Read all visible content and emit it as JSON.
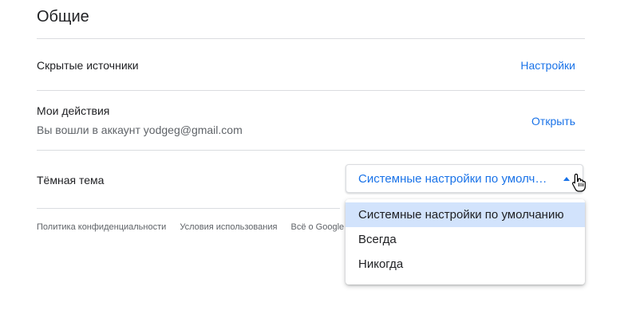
{
  "section": {
    "title": "Общие"
  },
  "rows": [
    {
      "label": "Скрытые источники",
      "action": "Настройки"
    },
    {
      "label": "Мои действия",
      "sub": "Вы вошли в аккаунт yodgeg@gmail.com",
      "action": "Открыть"
    },
    {
      "label": "Тёмная тема"
    }
  ],
  "theme_select": {
    "value": "Системные настройки по умолчанию",
    "options": [
      {
        "label": "Системные настройки по умолчанию",
        "selected": true
      },
      {
        "label": "Всегда",
        "selected": false
      },
      {
        "label": "Никогда",
        "selected": false
      }
    ]
  },
  "footer": {
    "links": [
      "Политика конфиденциальности",
      "Условия использования",
      "Всё о Google"
    ]
  },
  "colors": {
    "accent": "#1a73e8",
    "selected_bg": "#d2e3fc",
    "divider": "#dadce0"
  },
  "icons": {
    "caret": "caret-up-icon",
    "cursor": "hand-cursor-icon"
  }
}
